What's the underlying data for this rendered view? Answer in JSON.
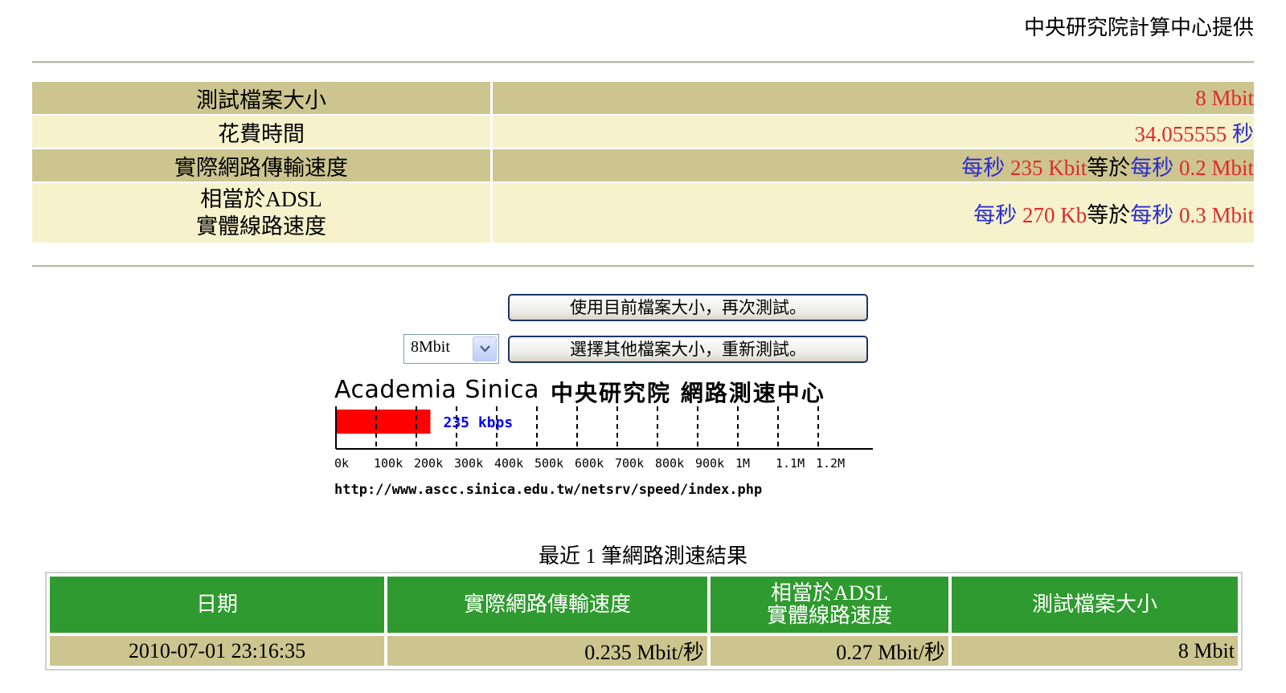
{
  "header": {
    "provider": "中央研究院計算中心提供"
  },
  "results": {
    "file_size_label": "測試檔案大小",
    "file_size_value": "8 Mbit",
    "time_label": "花費時間",
    "time_value": "34.055555",
    "time_unit": "秒",
    "speed_label": "實際網路傳輸速度",
    "speed_parts": {
      "per1": "每秒",
      "kbit": "235 Kbit",
      "equals": "等於",
      "per2": "每秒",
      "mbit": "0.2 Mbit"
    },
    "adsl_label_line1": "相當於ADSL",
    "adsl_label_line2": "實體線路速度",
    "adsl_parts": {
      "per1": "每秒",
      "kb": "270 Kb",
      "equals": "等於",
      "per2": "每秒",
      "mbit": "0.3 Mbit"
    }
  },
  "controls": {
    "retest_button": "使用目前檔案大小，再次測試。",
    "size_select_value": "8Mbit",
    "new_size_button": "選擇其他檔案大小，重新測試。"
  },
  "meter": {
    "title_en": "Academia Sinica",
    "title_zh": "中央研究院 網路測速中心",
    "speed_label": "235 kbps",
    "url": "http://www.ascc.sinica.edu.tw/netsrv/speed/index.php",
    "accent_color": "#ff0000",
    "label_color": "#0000ff"
  },
  "chart_data": {
    "type": "bar",
    "categories": [
      "speed"
    ],
    "values": [
      235
    ],
    "unit": "kbps",
    "xlim": [
      0,
      1200
    ],
    "tick_labels": [
      "0k",
      "100k",
      "200k",
      "300k",
      "400k",
      "500k",
      "600k",
      "700k",
      "800k",
      "900k",
      "1M",
      "1.1M",
      "1.2M"
    ],
    "tick_values": [
      0,
      100,
      200,
      300,
      400,
      500,
      600,
      700,
      800,
      900,
      1000,
      1100,
      1200
    ],
    "grid": true
  },
  "history": {
    "title": "最近 1 筆網路測速結果",
    "columns": [
      "日期",
      "實際網路傳輸速度",
      "相當於ADSL\n實體線路速度",
      "測試檔案大小"
    ],
    "column3_line1": "相當於ADSL",
    "column3_line2": "實體線路速度",
    "rows": [
      {
        "date": "2010-07-01 23:16:35",
        "speed": "0.235 Mbit/秒",
        "adsl": "0.27 Mbit/秒",
        "size": "8 Mbit"
      }
    ]
  }
}
